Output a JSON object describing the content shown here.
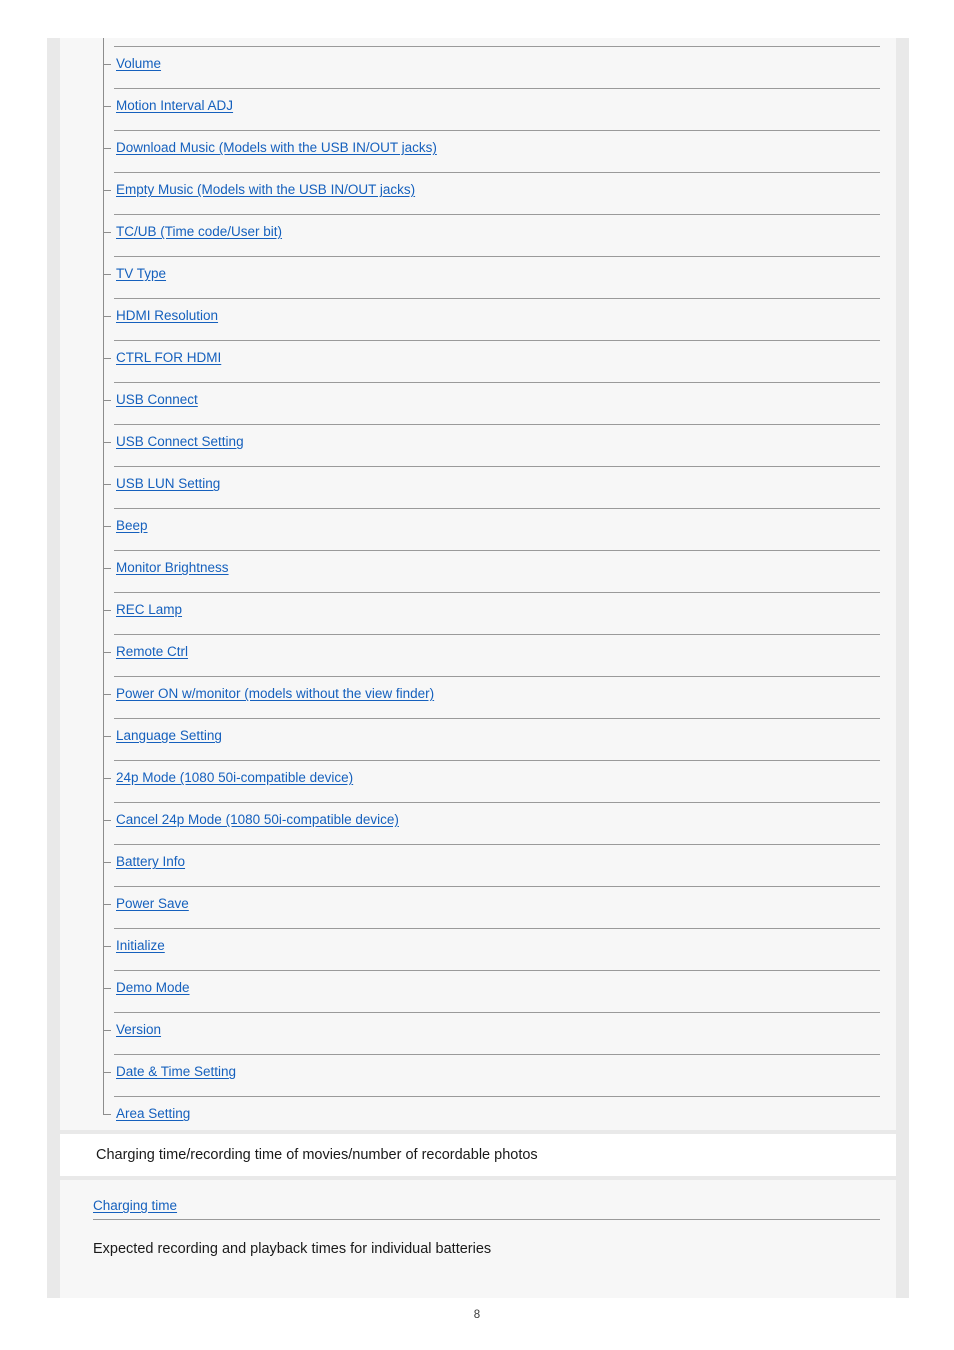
{
  "document": {
    "page_number": "8",
    "colors": {
      "link": "#1560bd",
      "text": "#1a1a1a",
      "rule": "#9a9a9a",
      "tree_line": "#8d8d8d",
      "panel_background": "#f7f7f7",
      "gutter_background": "#e9e9e9",
      "heading_background": "#ffffff"
    }
  },
  "toc": {
    "items": [
      {
        "label": "Volume"
      },
      {
        "label": "Motion Interval ADJ"
      },
      {
        "label": "Download Music (Models with the USB IN/OUT jacks)"
      },
      {
        "label": "Empty Music (Models with the USB IN/OUT jacks)"
      },
      {
        "label": "TC/UB (Time code/User bit)"
      },
      {
        "label": "TV Type"
      },
      {
        "label": "HDMI Resolution"
      },
      {
        "label": "CTRL FOR HDMI"
      },
      {
        "label": "USB Connect"
      },
      {
        "label": "USB Connect Setting"
      },
      {
        "label": "USB LUN Setting"
      },
      {
        "label": "Beep"
      },
      {
        "label": "Monitor Brightness"
      },
      {
        "label": "REC Lamp"
      },
      {
        "label": "Remote Ctrl"
      },
      {
        "label": "Power ON w/monitor (models without the view finder)"
      },
      {
        "label": "Language Setting"
      },
      {
        "label": "24p Mode (1080 50i-compatible device)"
      },
      {
        "label": "Cancel 24p Mode (1080 50i-compatible device)"
      },
      {
        "label": "Battery Info"
      },
      {
        "label": "Power Save"
      },
      {
        "label": "Initialize"
      },
      {
        "label": "Demo Mode"
      },
      {
        "label": "Version"
      },
      {
        "label": "Date & Time Setting"
      },
      {
        "label": "Area Setting"
      }
    ]
  },
  "section": {
    "heading": "Charging time/recording time of movies/number of recordable photos",
    "links": [
      {
        "label": "Charging time"
      }
    ],
    "notes": [
      {
        "text": "Expected recording and playback times for individual batteries"
      }
    ]
  }
}
